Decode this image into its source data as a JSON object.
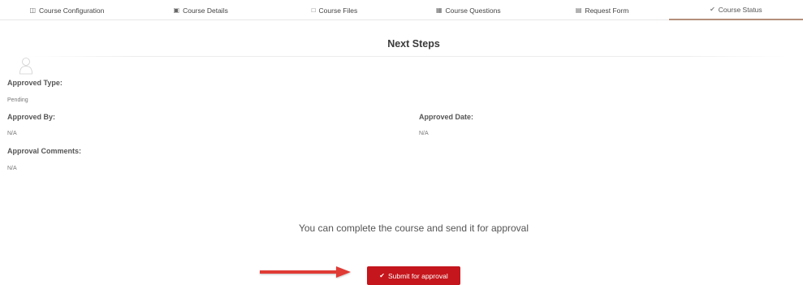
{
  "tabs": [
    {
      "label": "Course Configuration",
      "icon": "file-icon"
    },
    {
      "label": "Course Details",
      "icon": "id-card-icon"
    },
    {
      "label": "Course Files",
      "icon": "file-add-icon"
    },
    {
      "label": "Course Questions",
      "icon": "chat-icon"
    },
    {
      "label": "Request Form",
      "icon": "form-icon"
    },
    {
      "label": "Course Status",
      "icon": "check-icon"
    }
  ],
  "section": {
    "title": "Next Steps"
  },
  "fields": {
    "approved_type": {
      "label": "Approved Type:",
      "value": "Pending"
    },
    "approved_by": {
      "label": "Approved By:",
      "value": "N/A"
    },
    "approved_date": {
      "label": "Approved Date:",
      "value": "N/A"
    },
    "approval_comments": {
      "label": "Approval Comments:",
      "value": "N/A"
    }
  },
  "message": "You can complete the course and send it for approval",
  "submit": {
    "label": "Submit for approval",
    "icon": "check-icon",
    "color": "#c4161c"
  },
  "colors": {
    "active_tab_underline": "#b48f7a",
    "arrow": "#e03a35"
  }
}
